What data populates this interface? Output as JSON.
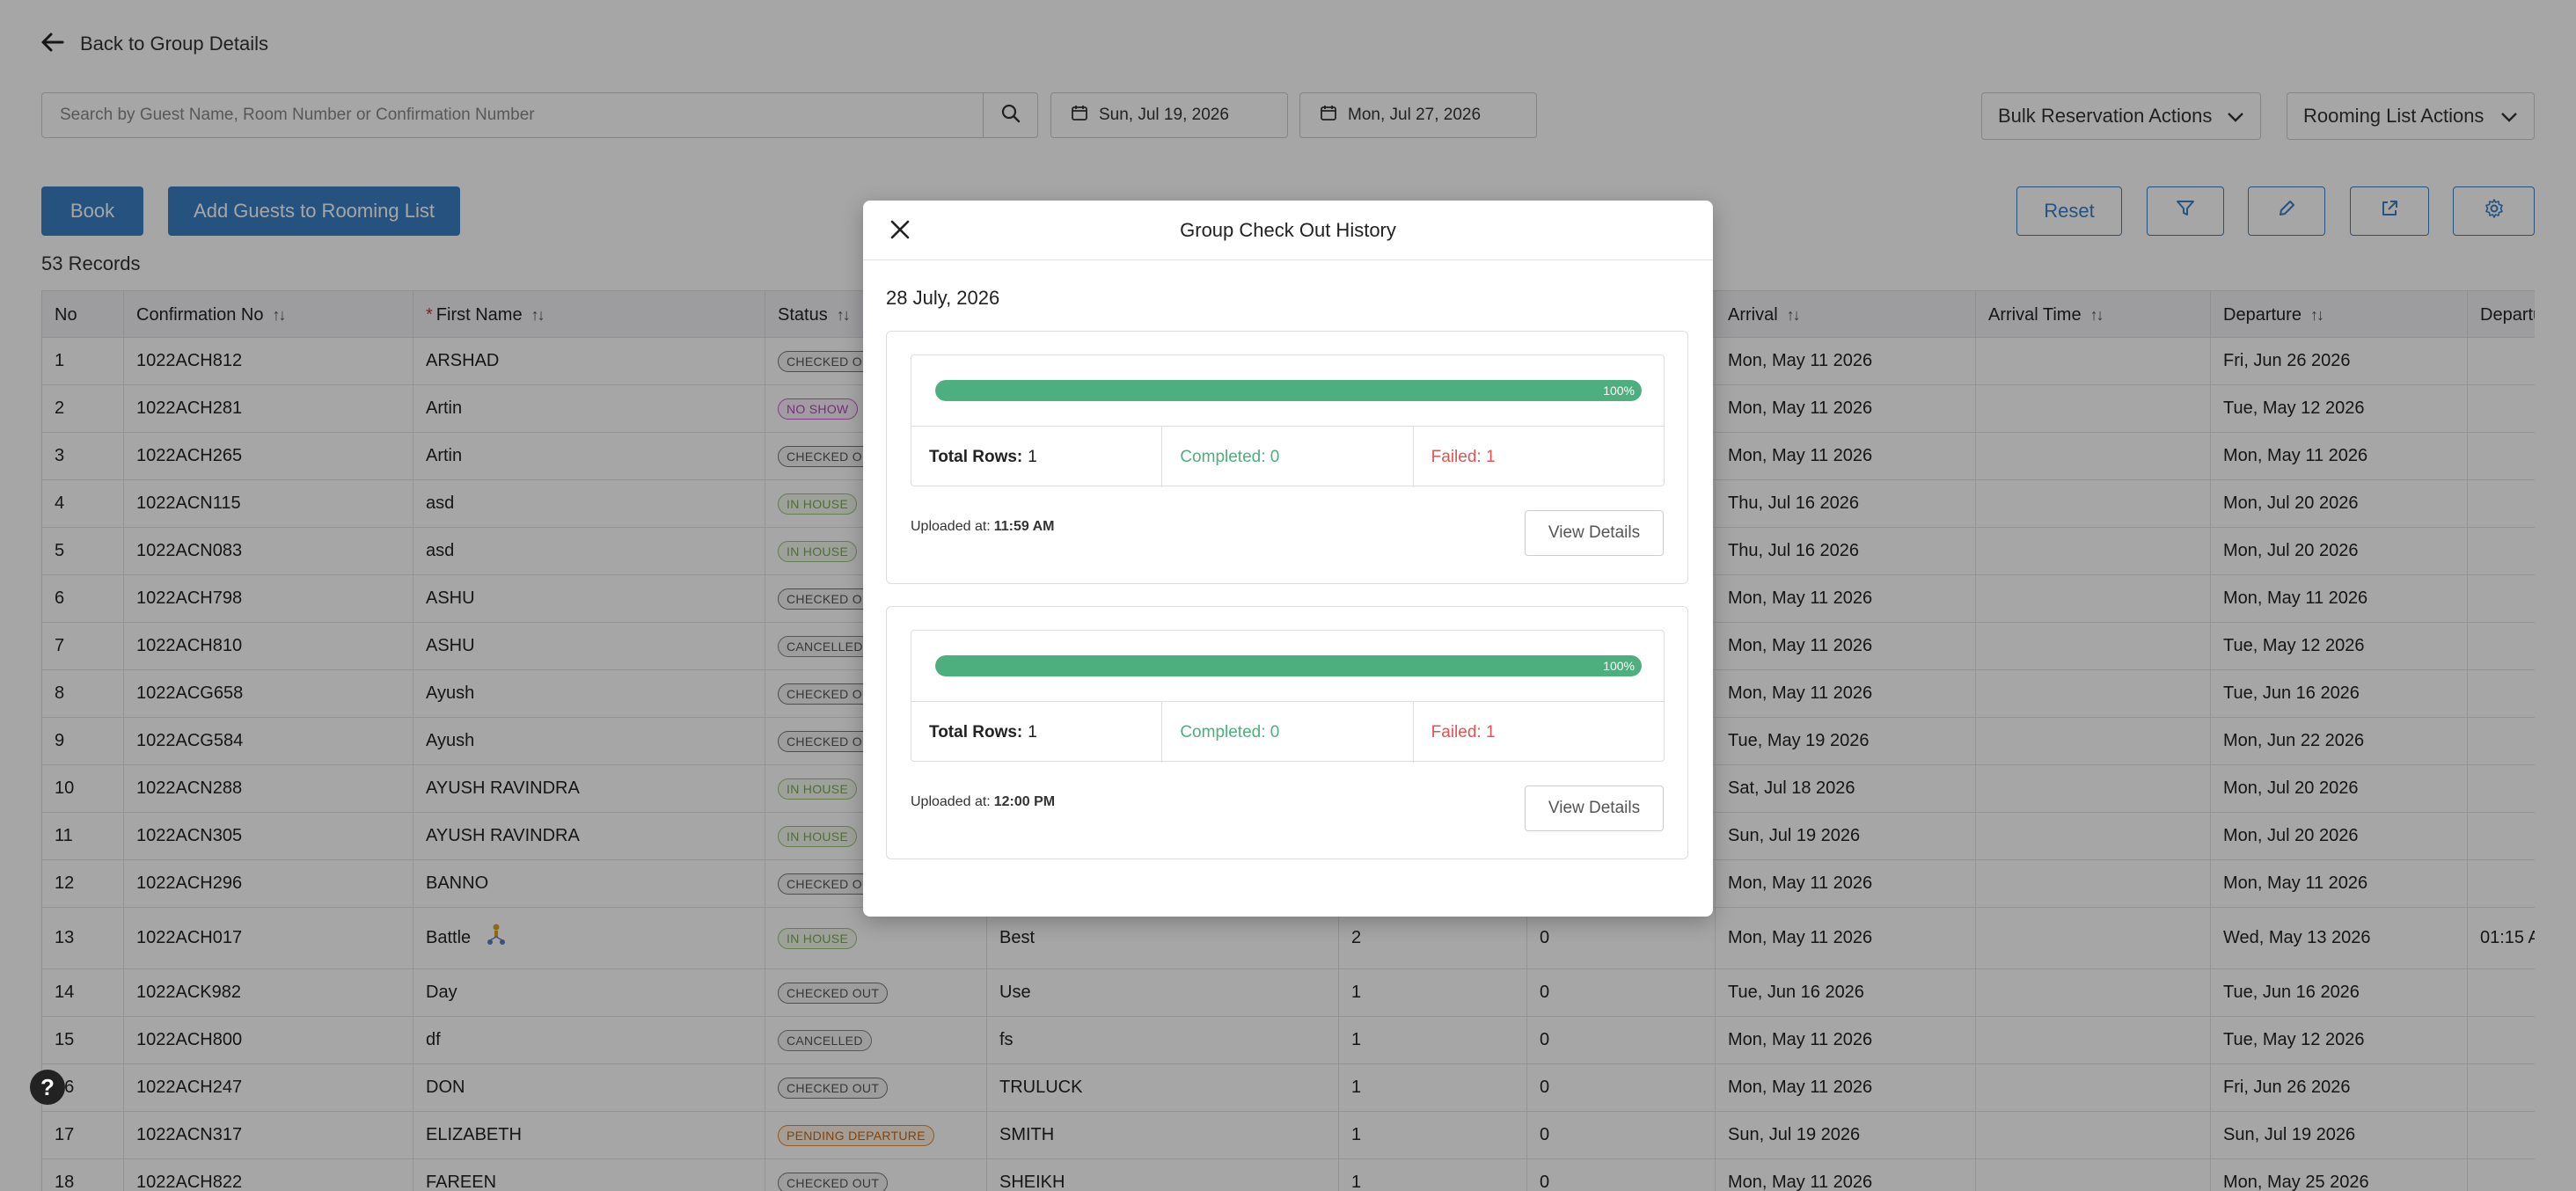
{
  "back_link": "Back to Group Details",
  "search": {
    "placeholder": "Search by Guest Name, Room Number or Confirmation Number"
  },
  "dates": {
    "start": "Sun, Jul 19, 2026",
    "end": "Mon, Jul 27, 2026"
  },
  "actions": {
    "bulk": "Bulk Reservation Actions",
    "rooming": "Rooming List Actions"
  },
  "buttons": {
    "book": "Book",
    "add_guests": "Add Guests to Rooming List",
    "reset": "Reset"
  },
  "records_label": "53 Records",
  "table": {
    "headers": {
      "no": "No",
      "conf": "Confirmation No",
      "first": "First Name",
      "status": "Status",
      "arrival": "Arrival",
      "arrival_time": "Arrival Time",
      "departure": "Departure",
      "departure_time": "Departu"
    },
    "rows": [
      {
        "no": "1",
        "conf": "1022ACH812",
        "first": "ARSHAD",
        "status": "CHECKED OUT",
        "last": "",
        "c1": "",
        "c2": "",
        "arrival": "Mon, May 11 2026",
        "departure": "Fri, Jun 26 2026",
        "dtime": ""
      },
      {
        "no": "2",
        "conf": "1022ACH281",
        "first": "Artin",
        "status": "NO SHOW",
        "last": "",
        "c1": "",
        "c2": "",
        "arrival": "Mon, May 11 2026",
        "departure": "Tue, May 12 2026",
        "dtime": ""
      },
      {
        "no": "3",
        "conf": "1022ACH265",
        "first": "Artin",
        "status": "CHECKED OUT",
        "last": "",
        "c1": "",
        "c2": "",
        "arrival": "Mon, May 11 2026",
        "departure": "Mon, May 11 2026",
        "dtime": ""
      },
      {
        "no": "4",
        "conf": "1022ACN115",
        "first": "asd",
        "status": "IN HOUSE",
        "last": "",
        "c1": "",
        "c2": "",
        "arrival": "Thu, Jul 16 2026",
        "departure": "Mon, Jul 20 2026",
        "dtime": ""
      },
      {
        "no": "5",
        "conf": "1022ACN083",
        "first": "asd",
        "status": "IN HOUSE",
        "last": "",
        "c1": "",
        "c2": "",
        "arrival": "Thu, Jul 16 2026",
        "departure": "Mon, Jul 20 2026",
        "dtime": ""
      },
      {
        "no": "6",
        "conf": "1022ACH798",
        "first": "ASHU",
        "status": "CHECKED OUT",
        "last": "",
        "c1": "",
        "c2": "",
        "arrival": "Mon, May 11 2026",
        "departure": "Mon, May 11 2026",
        "dtime": ""
      },
      {
        "no": "7",
        "conf": "1022ACH810",
        "first": "ASHU",
        "status": "CANCELLED",
        "last": "",
        "c1": "",
        "c2": "",
        "arrival": "Mon, May 11 2026",
        "departure": "Tue, May 12 2026",
        "dtime": ""
      },
      {
        "no": "8",
        "conf": "1022ACG658",
        "first": "Ayush",
        "status": "CHECKED OUT",
        "last": "",
        "c1": "",
        "c2": "",
        "arrival": "Mon, May 11 2026",
        "departure": "Tue, Jun 16 2026",
        "dtime": ""
      },
      {
        "no": "9",
        "conf": "1022ACG584",
        "first": "Ayush",
        "status": "CHECKED OUT",
        "last": "",
        "c1": "",
        "c2": "",
        "arrival": "Tue, May 19 2026",
        "departure": "Mon, Jun 22 2026",
        "dtime": ""
      },
      {
        "no": "10",
        "conf": "1022ACN288",
        "first": "AYUSH RAVINDRA",
        "status": "IN HOUSE",
        "last": "",
        "c1": "",
        "c2": "",
        "arrival": "Sat, Jul 18 2026",
        "departure": "Mon, Jul 20 2026",
        "dtime": ""
      },
      {
        "no": "11",
        "conf": "1022ACN305",
        "first": "AYUSH RAVINDRA",
        "status": "IN HOUSE",
        "last": "",
        "c1": "",
        "c2": "",
        "arrival": "Sun, Jul 19 2026",
        "departure": "Mon, Jul 20 2026",
        "dtime": ""
      },
      {
        "no": "12",
        "conf": "1022ACH296",
        "first": "BANNO",
        "status": "CHECKED OUT",
        "last": "",
        "c1": "",
        "c2": "",
        "arrival": "Mon, May 11 2026",
        "departure": "Mon, May 11 2026",
        "dtime": ""
      },
      {
        "no": "13",
        "conf": "1022ACH017",
        "first": "Battle",
        "status": "IN HOUSE",
        "last": "Best",
        "c1": "2",
        "c2": "0",
        "arrival": "Mon, May 11 2026",
        "departure": "Wed, May 13 2026",
        "dtime": "01:15 A"
      },
      {
        "no": "14",
        "conf": "1022ACK982",
        "first": "Day",
        "status": "CHECKED OUT",
        "last": "Use",
        "c1": "1",
        "c2": "0",
        "arrival": "Tue, Jun 16 2026",
        "departure": "Tue, Jun 16 2026",
        "dtime": ""
      },
      {
        "no": "15",
        "conf": "1022ACH800",
        "first": "df",
        "status": "CANCELLED",
        "last": "fs",
        "c1": "1",
        "c2": "0",
        "arrival": "Mon, May 11 2026",
        "departure": "Tue, May 12 2026",
        "dtime": ""
      },
      {
        "no": "16",
        "conf": "1022ACH247",
        "first": "DON",
        "status": "CHECKED OUT",
        "last": "TRULUCK",
        "c1": "1",
        "c2": "0",
        "arrival": "Mon, May 11 2026",
        "departure": "Fri, Jun 26 2026",
        "dtime": ""
      },
      {
        "no": "17",
        "conf": "1022ACN317",
        "first": "ELIZABETH",
        "status": "PENDING DEPARTURE",
        "last": "SMITH",
        "c1": "1",
        "c2": "0",
        "arrival": "Sun, Jul 19 2026",
        "departure": "Sun, Jul 19 2026",
        "dtime": ""
      },
      {
        "no": "18",
        "conf": "1022ACH822",
        "first": "FAREEN",
        "status": "CHECKED OUT",
        "last": "SHEIKH",
        "c1": "1",
        "c2": "0",
        "arrival": "Mon, May 11 2026",
        "departure": "Mon, May 25 2026",
        "dtime": ""
      }
    ]
  },
  "modal": {
    "title": "Group Check Out History",
    "date": "28 July, 2026",
    "entries": [
      {
        "progress_pct": 100,
        "progress_label": "100%",
        "total_label": "Total Rows:",
        "total": "1",
        "completed": "Completed: 0",
        "failed": "Failed: 1",
        "uploaded_label": "Uploaded at:",
        "uploaded_time": "11:59 AM",
        "view": "View Details"
      },
      {
        "progress_pct": 100,
        "progress_label": "100%",
        "total_label": "Total Rows:",
        "total": "1",
        "completed": "Completed: 0",
        "failed": "Failed: 1",
        "uploaded_label": "Uploaded at:",
        "uploaded_time": "12:00 PM",
        "view": "View Details"
      }
    ]
  },
  "help": "?"
}
